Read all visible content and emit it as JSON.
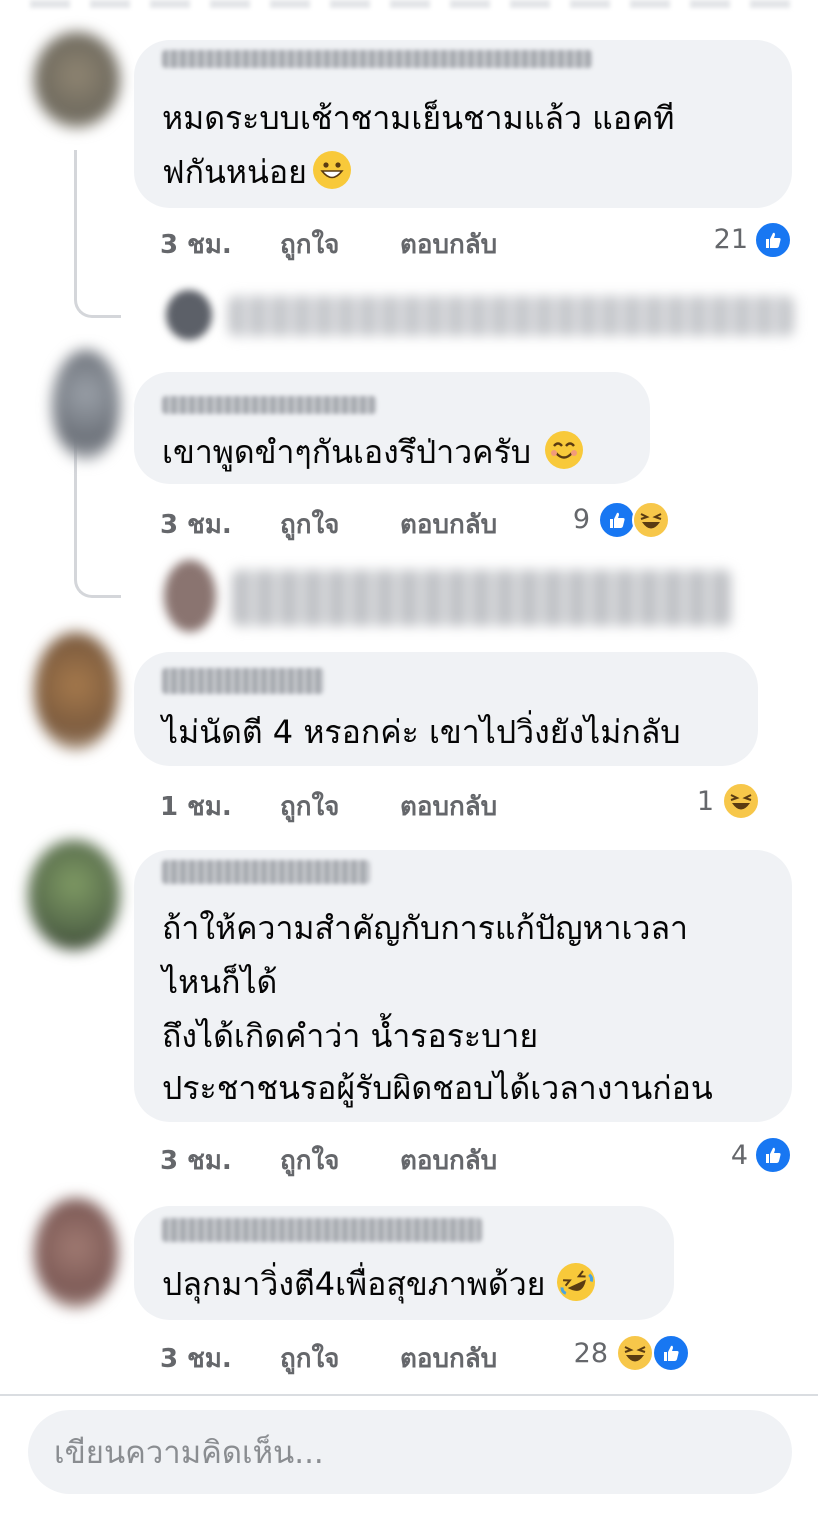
{
  "comments": [
    {
      "lines": [
        "หมดระบบเช้าชามเย็นชามแล้ว แอคที",
        "ฟกันหน่อย"
      ],
      "emoji": "grinning-face",
      "time": "3 ชม.",
      "like_label": "ถูกใจ",
      "reply_label": "ตอบกลับ",
      "reaction_count": "21",
      "reactions": [
        "like"
      ]
    },
    {
      "lines": [
        "เขาพูดขำๆกันเองรึป่าวครับ"
      ],
      "emoji": "smiling-face",
      "time": "3 ชม.",
      "like_label": "ถูกใจ",
      "reply_label": "ตอบกลับ",
      "reaction_count": "9",
      "reactions": [
        "like",
        "haha"
      ]
    },
    {
      "lines": [
        "ไม่นัดตี 4 หรอกค่ะ เขาไปวิ่งยังไม่กลับ"
      ],
      "time": "1 ชม.",
      "like_label": "ถูกใจ",
      "reply_label": "ตอบกลับ",
      "reaction_count": "1",
      "reactions": [
        "haha"
      ]
    },
    {
      "lines": [
        "ถ้าให้ความสำคัญกับการแก้ปัญหาเวลา",
        "ไหนก็ได้",
        "ถึงได้เกิดคำว่า น้ำรอระบาย",
        "ประชาชนรอผู้รับผิดชอบได้เวลางานก่อน"
      ],
      "time": "3 ชม.",
      "like_label": "ถูกใจ",
      "reply_label": "ตอบกลับ",
      "reaction_count": "4",
      "reactions": [
        "like"
      ]
    },
    {
      "lines": [
        "ปลุกมาวิ่งตี4เพื่อสุขภาพด้วย"
      ],
      "emoji": "rolling-laughing-face",
      "time": "3 ชม.",
      "like_label": "ถูกใจ",
      "reply_label": "ตอบกลับ",
      "reaction_count": "28",
      "reactions": [
        "haha",
        "like"
      ]
    }
  ],
  "composer": {
    "placeholder": "เขียนความคิดเห็น..."
  },
  "colors": {
    "bubble": "#f0f2f5",
    "like": "#1877f2",
    "meta": "#65676b",
    "haha": "#f7c74a"
  }
}
